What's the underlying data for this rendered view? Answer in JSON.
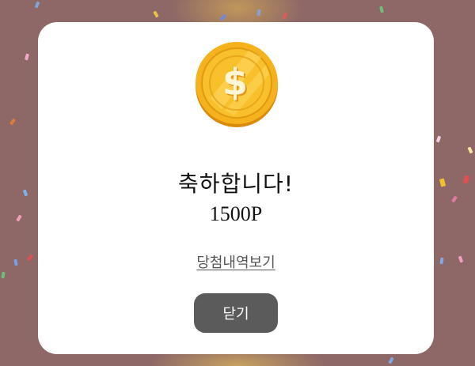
{
  "modal": {
    "title": "축하합니다!",
    "points": "1500P",
    "history_link_label": "당첨내역보기",
    "close_button_label": "닫기"
  },
  "icons": {
    "coin": "dollar-coin-icon"
  },
  "colors": {
    "overlay": "#8e6767",
    "modal_background": "#ffffff",
    "close_button": "#5b5b5b",
    "coin_gold": "#f5b21c",
    "coin_dark": "#d98c0a"
  }
}
